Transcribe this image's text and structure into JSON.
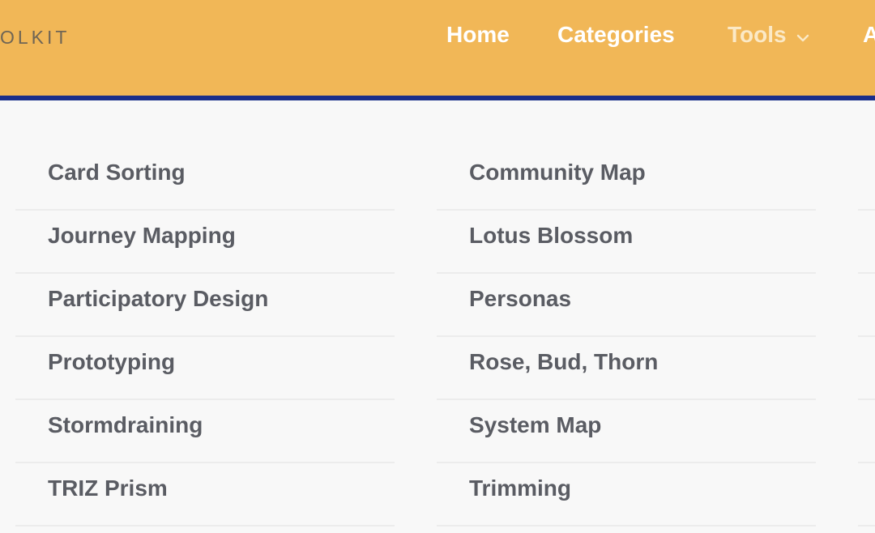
{
  "header": {
    "logo_text": "OLKIT",
    "nav": [
      {
        "label": "Home"
      },
      {
        "label": "Categories"
      },
      {
        "label": "Tools"
      },
      {
        "label": "A"
      }
    ]
  },
  "menu": {
    "columns": [
      {
        "items": [
          {
            "label": "Card Sorting"
          },
          {
            "label": "Journey Mapping"
          },
          {
            "label": "Participatory Design"
          },
          {
            "label": "Prototyping"
          },
          {
            "label": "Stormdraining"
          },
          {
            "label": "TRIZ Prism"
          }
        ]
      },
      {
        "items": [
          {
            "label": "Community Map"
          },
          {
            "label": "Lotus Blossom"
          },
          {
            "label": "Personas"
          },
          {
            "label": "Rose, Bud, Thorn"
          },
          {
            "label": "System Map"
          },
          {
            "label": "Trimming"
          }
        ]
      }
    ]
  },
  "colors": {
    "header_bg": "#f1b757",
    "header_border": "#1a2e8a",
    "nav_text": "#ffffff",
    "nav_active_text": "#fbe9c6",
    "menu_bg": "#f8f8f8",
    "item_text": "#5a5c63"
  },
  "icons": {
    "tools_dropdown": "chevron-down-icon"
  }
}
